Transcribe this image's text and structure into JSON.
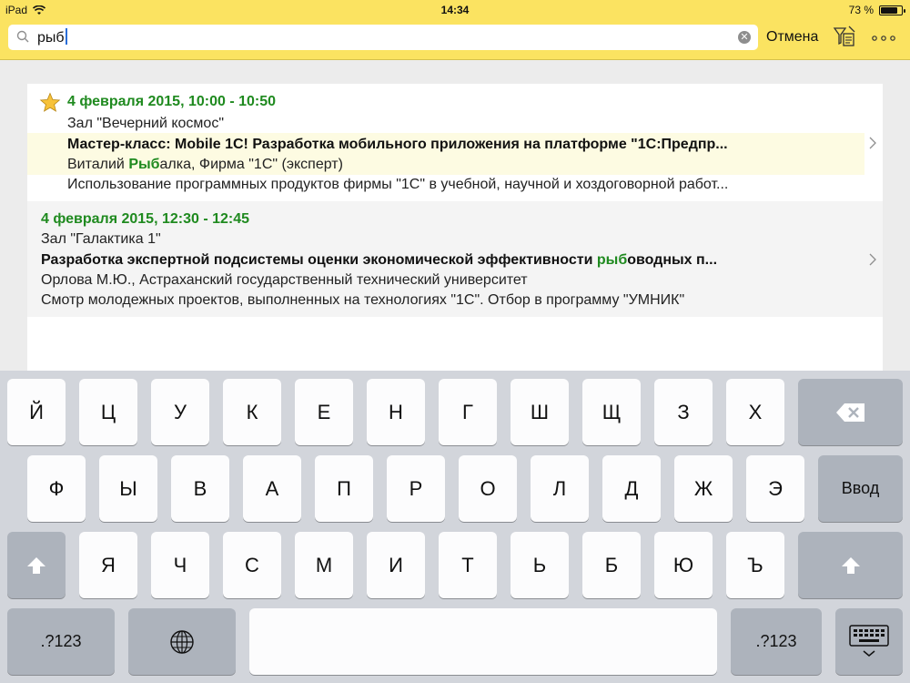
{
  "status_bar": {
    "device": "iPad",
    "time": "14:34",
    "battery_text": "73 %",
    "battery_level": 0.73
  },
  "search": {
    "value": "рыб",
    "cancel_label": "Отмена"
  },
  "events": [
    {
      "starred": true,
      "date": "4 февраля 2015, 10:00 - 10:50",
      "room": "Зал \"Вечерний космос\"",
      "title": "Мастер-класс: Mobile 1C! Разработка мобильного приложения на платформе \"1С:Предпр...",
      "speaker_pre": "Виталий ",
      "speaker_hl": "Рыб",
      "speaker_post": "алка, Фирма \"1С\" (эксперт)",
      "description": "Использование программных продуктов фирмы \"1С\" в учебной, научной и хоздоговорной работ..."
    },
    {
      "starred": false,
      "date": "4 февраля 2015, 12:30 - 12:45",
      "room": "Зал \"Галактика 1\"",
      "title_pre": "Разработка экспертной подсистемы оценки экономической эффективности ",
      "title_hl": "рыб",
      "title_post": "оводных п...",
      "speaker": "Орлова М.Ю., Астраханский государственный технический университет",
      "description": "Смотр молодежных проектов, выполненных на технологиях \"1С\". Отбор в программу \"УМНИК\""
    }
  ],
  "keyboard": {
    "row1": [
      "Й",
      "Ц",
      "У",
      "К",
      "Е",
      "Н",
      "Г",
      "Ш",
      "Щ",
      "З",
      "Х"
    ],
    "row2": [
      "Ф",
      "Ы",
      "В",
      "А",
      "П",
      "Р",
      "О",
      "Л",
      "Д",
      "Ж",
      "Э"
    ],
    "row3": [
      "Я",
      "Ч",
      "С",
      "М",
      "И",
      "Т",
      "Ь",
      "Б",
      "Ю",
      "Ъ"
    ],
    "enter_label": "Ввод",
    "numbers_label": ".?123",
    "icons": [
      "backspace-icon",
      "shift-icon",
      "globe-icon",
      "keyboard-hide-icon"
    ]
  }
}
